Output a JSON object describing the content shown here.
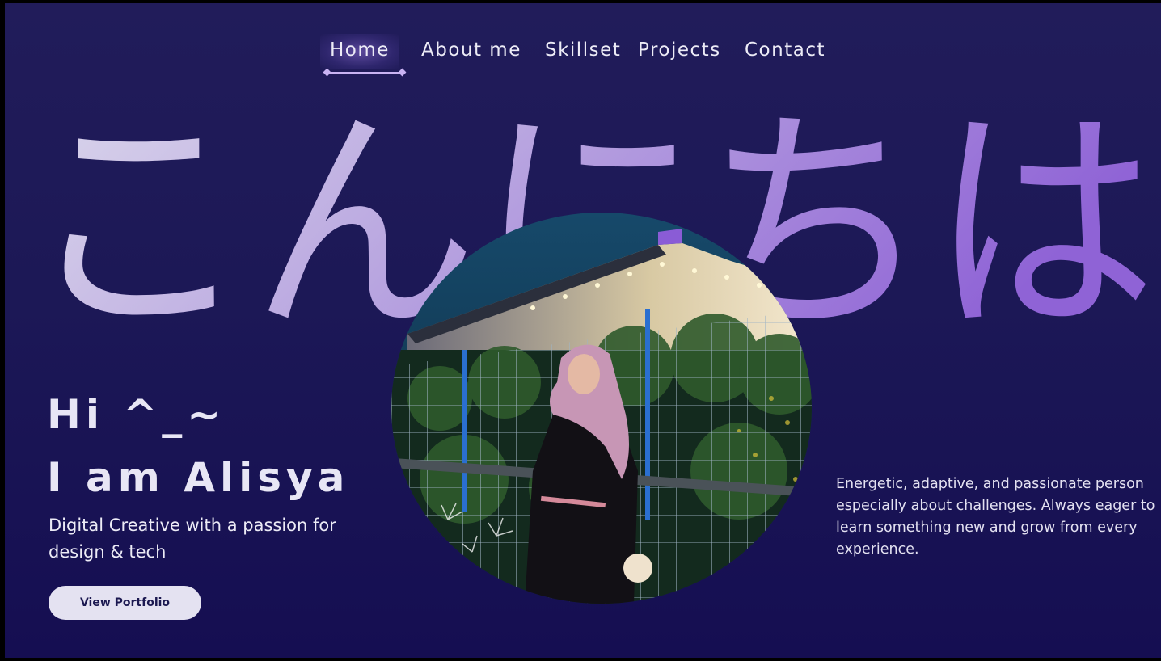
{
  "nav": {
    "items": [
      {
        "label": "Home",
        "active": true
      },
      {
        "label": "About me",
        "active": false
      },
      {
        "label": "Skillset",
        "active": false
      },
      {
        "label": "Projects",
        "active": false
      },
      {
        "label": "Contact",
        "active": false
      }
    ]
  },
  "hero": {
    "japanese_text": "こんにちは",
    "greeting_line1": "Hi ^_~",
    "greeting_line2": "I am Alisya",
    "tagline": "Digital Creative with a passion for design & tech",
    "cta_label": "View Portfolio",
    "description": "Energetic, adaptive, and passionate person especially about challenges. Always eager to learn something new and grow from every experience."
  },
  "colors": {
    "background_top": "#211c5a",
    "background_bottom": "#150e52",
    "accent": "#c9b3f3",
    "hero_text_light": "#d9d6ec",
    "hero_text_purple": "#8f63d6",
    "button_bg": "#e4e2f1"
  }
}
